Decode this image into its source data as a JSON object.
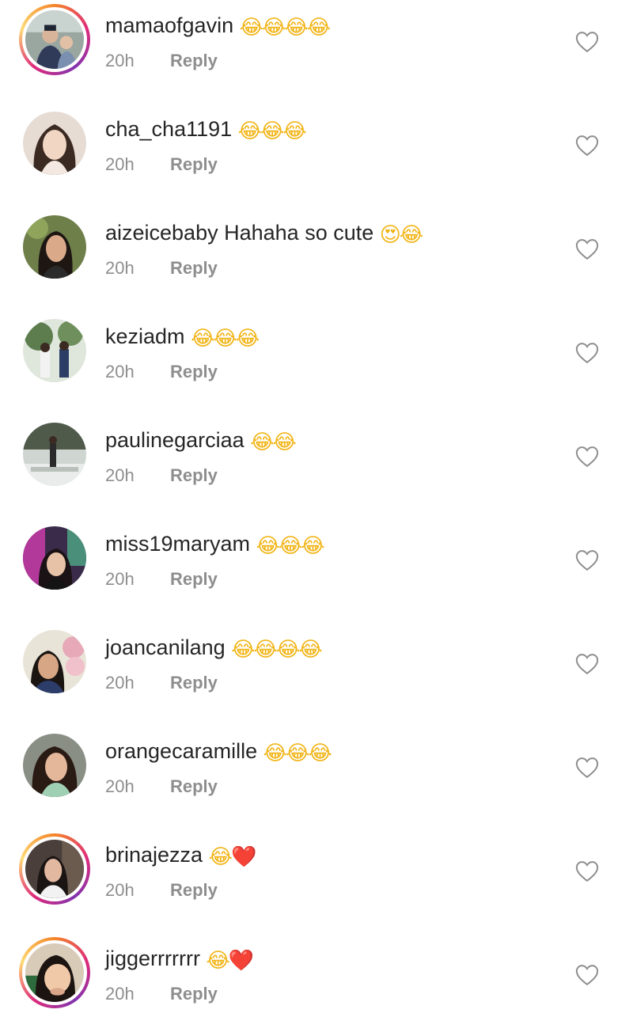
{
  "reply_label": "Reply",
  "time": "20h",
  "colors": {
    "text": "#262626",
    "secondary": "#8e8e8e",
    "heart_red": "#e8272c",
    "emoji_yellow": "#f2b518"
  },
  "comments": [
    {
      "username": "mamaofgavin",
      "message": "",
      "emojis": "😂😂😂😂",
      "story_ring": true,
      "avatar_icon": "avatar-photo"
    },
    {
      "username": "cha_cha1191",
      "message": "",
      "emojis": "😂😂😂",
      "story_ring": false,
      "avatar_icon": "avatar-photo"
    },
    {
      "username": "aizeicebaby",
      "message": "Hahaha so cute",
      "emojis": "😍😂",
      "story_ring": false,
      "avatar_icon": "avatar-photo"
    },
    {
      "username": "keziadm",
      "message": "",
      "emojis": "😂😂😂",
      "story_ring": false,
      "avatar_icon": "avatar-photo"
    },
    {
      "username": "paulinegarciaa",
      "message": "",
      "emojis": "😂😂",
      "story_ring": false,
      "avatar_icon": "avatar-photo"
    },
    {
      "username": "miss19maryam",
      "message": "",
      "emojis": "😂😂😂",
      "story_ring": false,
      "avatar_icon": "avatar-photo"
    },
    {
      "username": "joancanilang",
      "message": "",
      "emojis": "😂😂😂😂",
      "story_ring": false,
      "avatar_icon": "avatar-photo"
    },
    {
      "username": "orangecaramille",
      "message": "",
      "emojis": "😂😂😂",
      "story_ring": false,
      "avatar_icon": "avatar-photo"
    },
    {
      "username": "brinajezza",
      "message": "",
      "emojis": "😂❤️",
      "story_ring": true,
      "avatar_icon": "avatar-photo"
    },
    {
      "username": "jiggerrrrrrr",
      "message": "",
      "emojis": "😂❤️",
      "story_ring": true,
      "avatar_icon": "avatar-photo"
    }
  ]
}
